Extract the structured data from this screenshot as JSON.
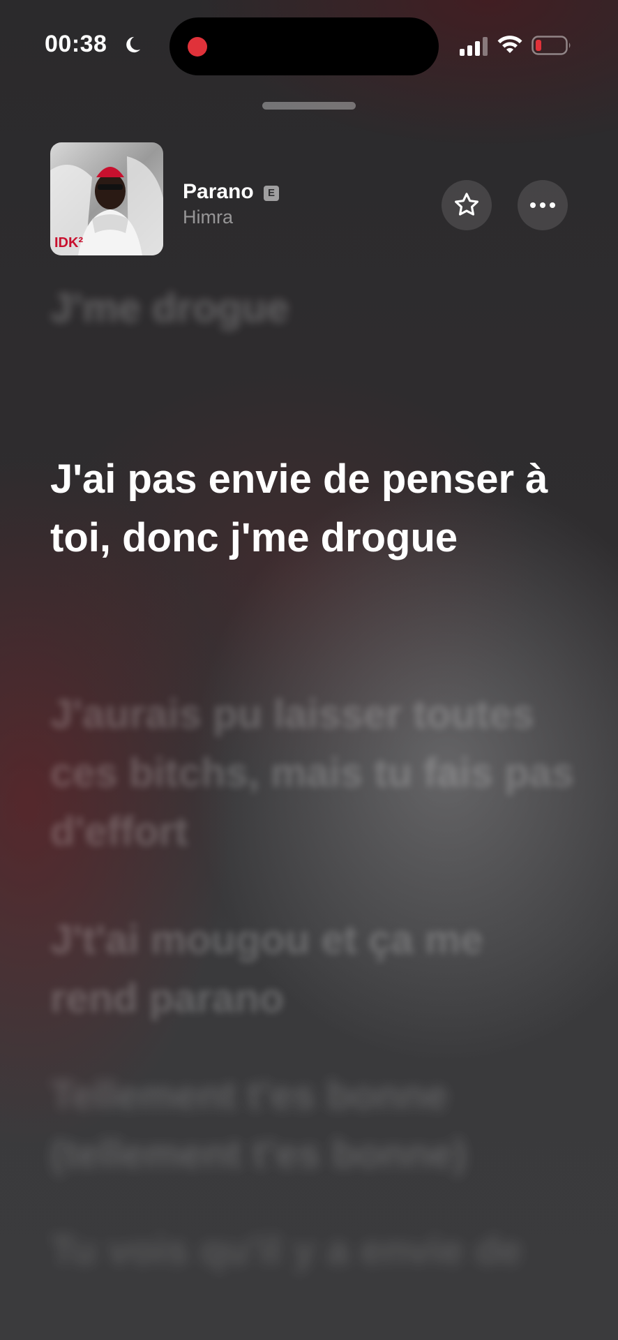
{
  "status_bar": {
    "time": "00:38",
    "focus_icon": "moon-icon",
    "recording_indicator_color": "#e0323a",
    "signal_icon": "cellular-signal-icon",
    "wifi_icon": "wifi-icon",
    "battery_icon": "battery-low-icon",
    "battery_level": 0.15,
    "battery_color": "#e0323a"
  },
  "now_playing": {
    "title": "Parano",
    "explicit_badge": "E",
    "artist": "Himra",
    "artwork_text": "IDK²",
    "favorite_icon": "star-icon",
    "more_icon": "ellipsis-icon"
  },
  "lyrics": {
    "previous_line": "J'me drogue",
    "current_line": "J'ai pas envie de penser à toi, donc j'me drogue",
    "upcoming_lines": [
      "J'aurais pu laisser toutes ces bitchs, mais tu fais pas d'effort",
      "J't'ai mougou et ça me rend parano",
      "Tellement t'es bonne (tellement t'es bonne)",
      "Tu vois qu'il y a envie de"
    ]
  }
}
